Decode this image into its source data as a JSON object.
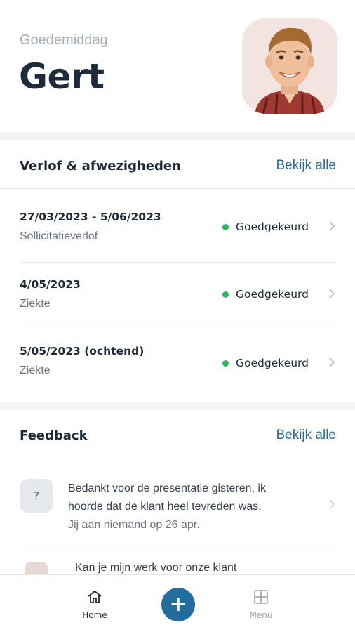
{
  "header": {
    "greeting": "Goedemiddag",
    "name": "Gert"
  },
  "leave": {
    "title": "Verlof & afwezigheden",
    "see_all": "Bekijk alle",
    "items": [
      {
        "date": "27/03/2023 - 5/06/2023",
        "type": "Sollicitatieverlof",
        "status": "Goedgekeurd"
      },
      {
        "date": "4/05/2023",
        "type": "Ziekte",
        "status": "Goedgekeurd"
      },
      {
        "date": "5/05/2023 (ochtend)",
        "type": "Ziekte",
        "status": "Goedgekeurd"
      }
    ]
  },
  "feedback": {
    "title": "Feedback",
    "see_all": "Bekijk alle",
    "items": [
      {
        "icon_text": "?",
        "message_line1": "Bedankt voor de presentatie gisteren, ik",
        "message_line2": "hoorde dat de klant heel tevreden was.",
        "meta": "Jij aan niemand op 26 apr."
      },
      {
        "message_line1": "Kan je mijn werk voor onze klant"
      }
    ]
  },
  "tabbar": {
    "home_label": "Home",
    "add_symbol": "+",
    "menu_label": "Menu"
  },
  "colors": {
    "accent": "#236d9c",
    "link": "#2a6b96",
    "status_approved": "#2eb85c",
    "greeting": "#a3acb9"
  },
  "icons": [
    "home-icon",
    "plus-icon",
    "grid-icon",
    "chevron-right-icon",
    "question-icon"
  ]
}
